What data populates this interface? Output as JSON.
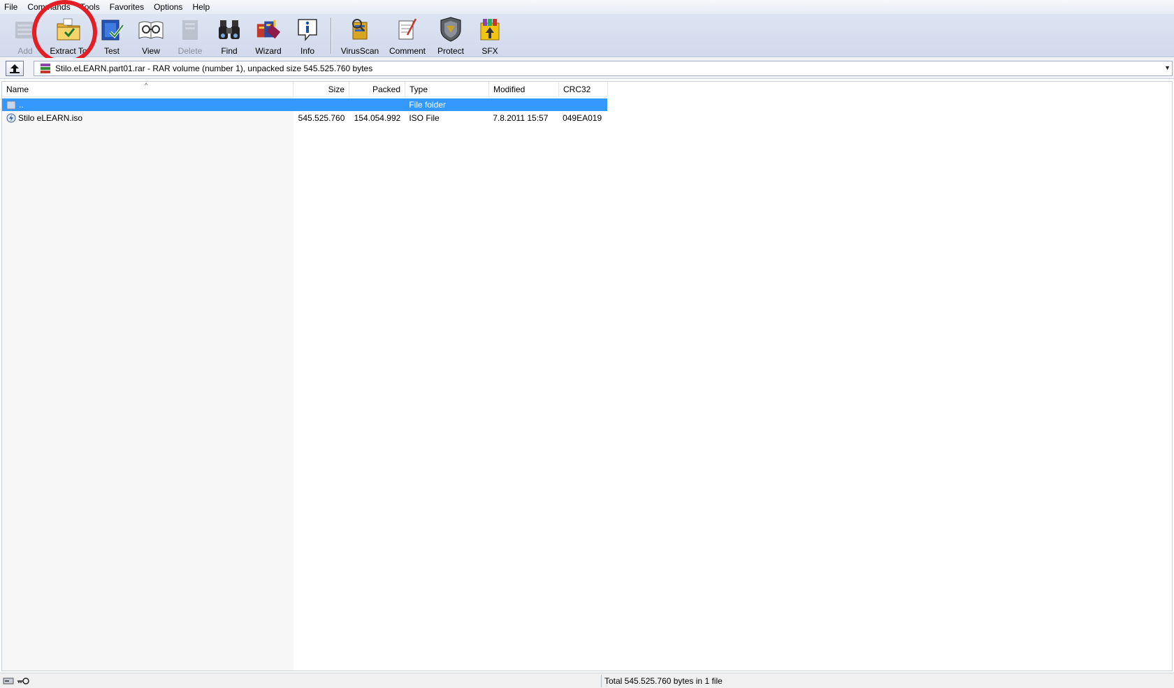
{
  "menu": {
    "items": [
      "File",
      "Commands",
      "Tools",
      "Favorites",
      "Options",
      "Help"
    ]
  },
  "toolbar": {
    "buttons": [
      {
        "label": "Add",
        "icon": "add-archive-icon",
        "enabled": false
      },
      {
        "label": "Extract To",
        "icon": "extract-to-icon",
        "enabled": true
      },
      {
        "label": "Test",
        "icon": "test-icon",
        "enabled": true
      },
      {
        "label": "View",
        "icon": "view-icon",
        "enabled": true
      },
      {
        "label": "Delete",
        "icon": "delete-icon",
        "enabled": false
      },
      {
        "label": "Find",
        "icon": "find-binoculars-icon",
        "enabled": true
      },
      {
        "label": "Wizard",
        "icon": "wizard-icon",
        "enabled": true
      },
      {
        "label": "Info",
        "icon": "info-icon",
        "enabled": true
      },
      {
        "label": "VirusScan",
        "icon": "virus-scan-icon",
        "enabled": true
      },
      {
        "label": "Comment",
        "icon": "comment-icon",
        "enabled": true
      },
      {
        "label": "Protect",
        "icon": "protect-shield-icon",
        "enabled": true
      },
      {
        "label": "SFX",
        "icon": "sfx-icon",
        "enabled": true
      }
    ],
    "highlight_color": "#e31e24"
  },
  "address": {
    "text": "Stilo.eLEARN.part01.rar - RAR volume (number 1), unpacked size 545.525.760 bytes"
  },
  "columns": [
    "Name",
    "Size",
    "Packed",
    "Type",
    "Modified",
    "CRC32"
  ],
  "rows": [
    {
      "name": "..",
      "size": "",
      "packed": "",
      "type": "File folder",
      "modified": "",
      "crc": "",
      "selected": true,
      "icon": "folder-up-icon"
    },
    {
      "name": "Stilo eLEARN.iso",
      "size": "545.525.760",
      "packed": "154.054.992",
      "type": "ISO File",
      "modified": "7.8.2011 15:57",
      "crc": "049EA019",
      "selected": false,
      "icon": "iso-file-icon"
    }
  ],
  "status": {
    "text": "Total 545.525.760 bytes in 1 file"
  },
  "colors": {
    "selection": "#3399ff",
    "toolbar_bg": "#d6deef"
  }
}
